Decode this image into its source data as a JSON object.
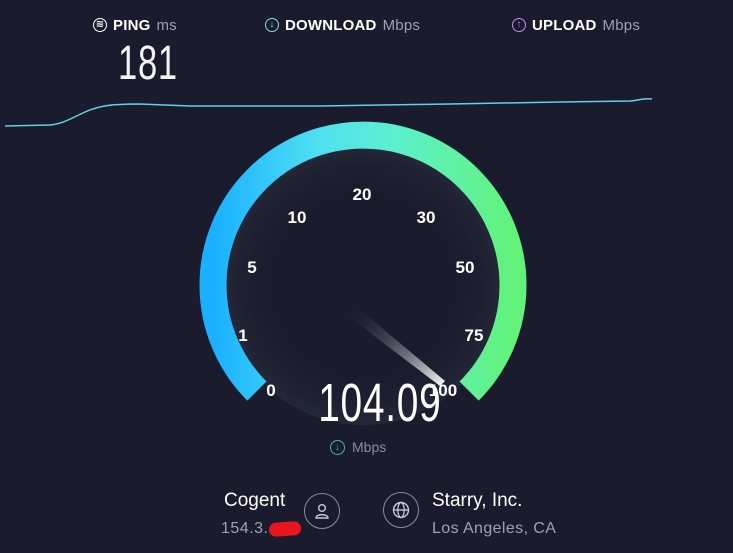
{
  "metrics": {
    "ping": {
      "label": "PING",
      "unit": "ms",
      "icon": "ping-icon",
      "value": "181"
    },
    "download": {
      "label": "DOWNLOAD",
      "unit": "Mbps",
      "icon": "download-arrow-icon"
    },
    "upload": {
      "label": "UPLOAD",
      "unit": "Mbps",
      "icon": "upload-arrow-icon"
    }
  },
  "gauge": {
    "scale_labels": [
      "0",
      "1",
      "5",
      "10",
      "20",
      "30",
      "50",
      "75",
      "100"
    ],
    "current_speed": "104.09",
    "unit": "Mbps",
    "needle_position_fraction": 1.0
  },
  "isp": {
    "name": "Cogent",
    "ip": "154.3.",
    "icon": "user-icon"
  },
  "server": {
    "name": "Starry, Inc.",
    "location": "Los Angeles, CA",
    "icon": "globe-icon"
  },
  "colors": {
    "background": "#1b1b2e",
    "gauge_start": "#1ab0ff",
    "gauge_mid": "#5cf0e0",
    "gauge_end": "#62f27a",
    "ping_graph": "#5fd2e6",
    "upload_accent": "#c58bf2",
    "download_accent": "#6ee6d8"
  }
}
